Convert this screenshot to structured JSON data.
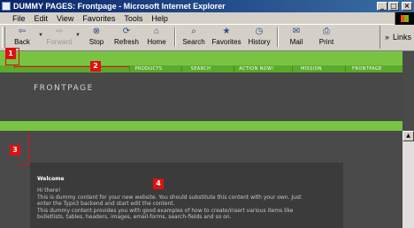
{
  "window": {
    "title": "DUMMY PAGES: Frontpage - Microsoft Internet Explorer",
    "controls": [
      "_",
      "□",
      "×"
    ]
  },
  "menu": [
    "File",
    "Edit",
    "View",
    "Favorites",
    "Tools",
    "Help"
  ],
  "toolbar": {
    "back": "Back",
    "forward": "Forward",
    "stop": "Stop",
    "refresh": "Refresh",
    "home": "Home",
    "search": "Search",
    "favorites": "Favorites",
    "history": "History",
    "mail": "Mail",
    "print": "Print",
    "links": "Links"
  },
  "site": {
    "nav": [
      "PRODUCTS",
      "SEARCH",
      "ACTION NOW!",
      "MISSION",
      "FRONTPAGE"
    ],
    "header_title": "FRONTPAGE",
    "welcome": "Welcome",
    "body_lines": [
      "Hi there!",
      "This is dummy content for your new website. You should substitute this content with your own. Just",
      "enter the Typo3 backend and start edit the content.",
      "This dummy content provides you with good examples of how to create/insert various items like",
      "bulletlists, tables, headers, images, email-forms, search-fields and so on."
    ]
  },
  "annotations": [
    "1",
    "2",
    "3",
    "4"
  ],
  "colors": {
    "accent_green": "#78c442",
    "nav_green": "#5aaa2c",
    "page_dark": "#4a4a4a",
    "annotation_red": "#e01010"
  }
}
